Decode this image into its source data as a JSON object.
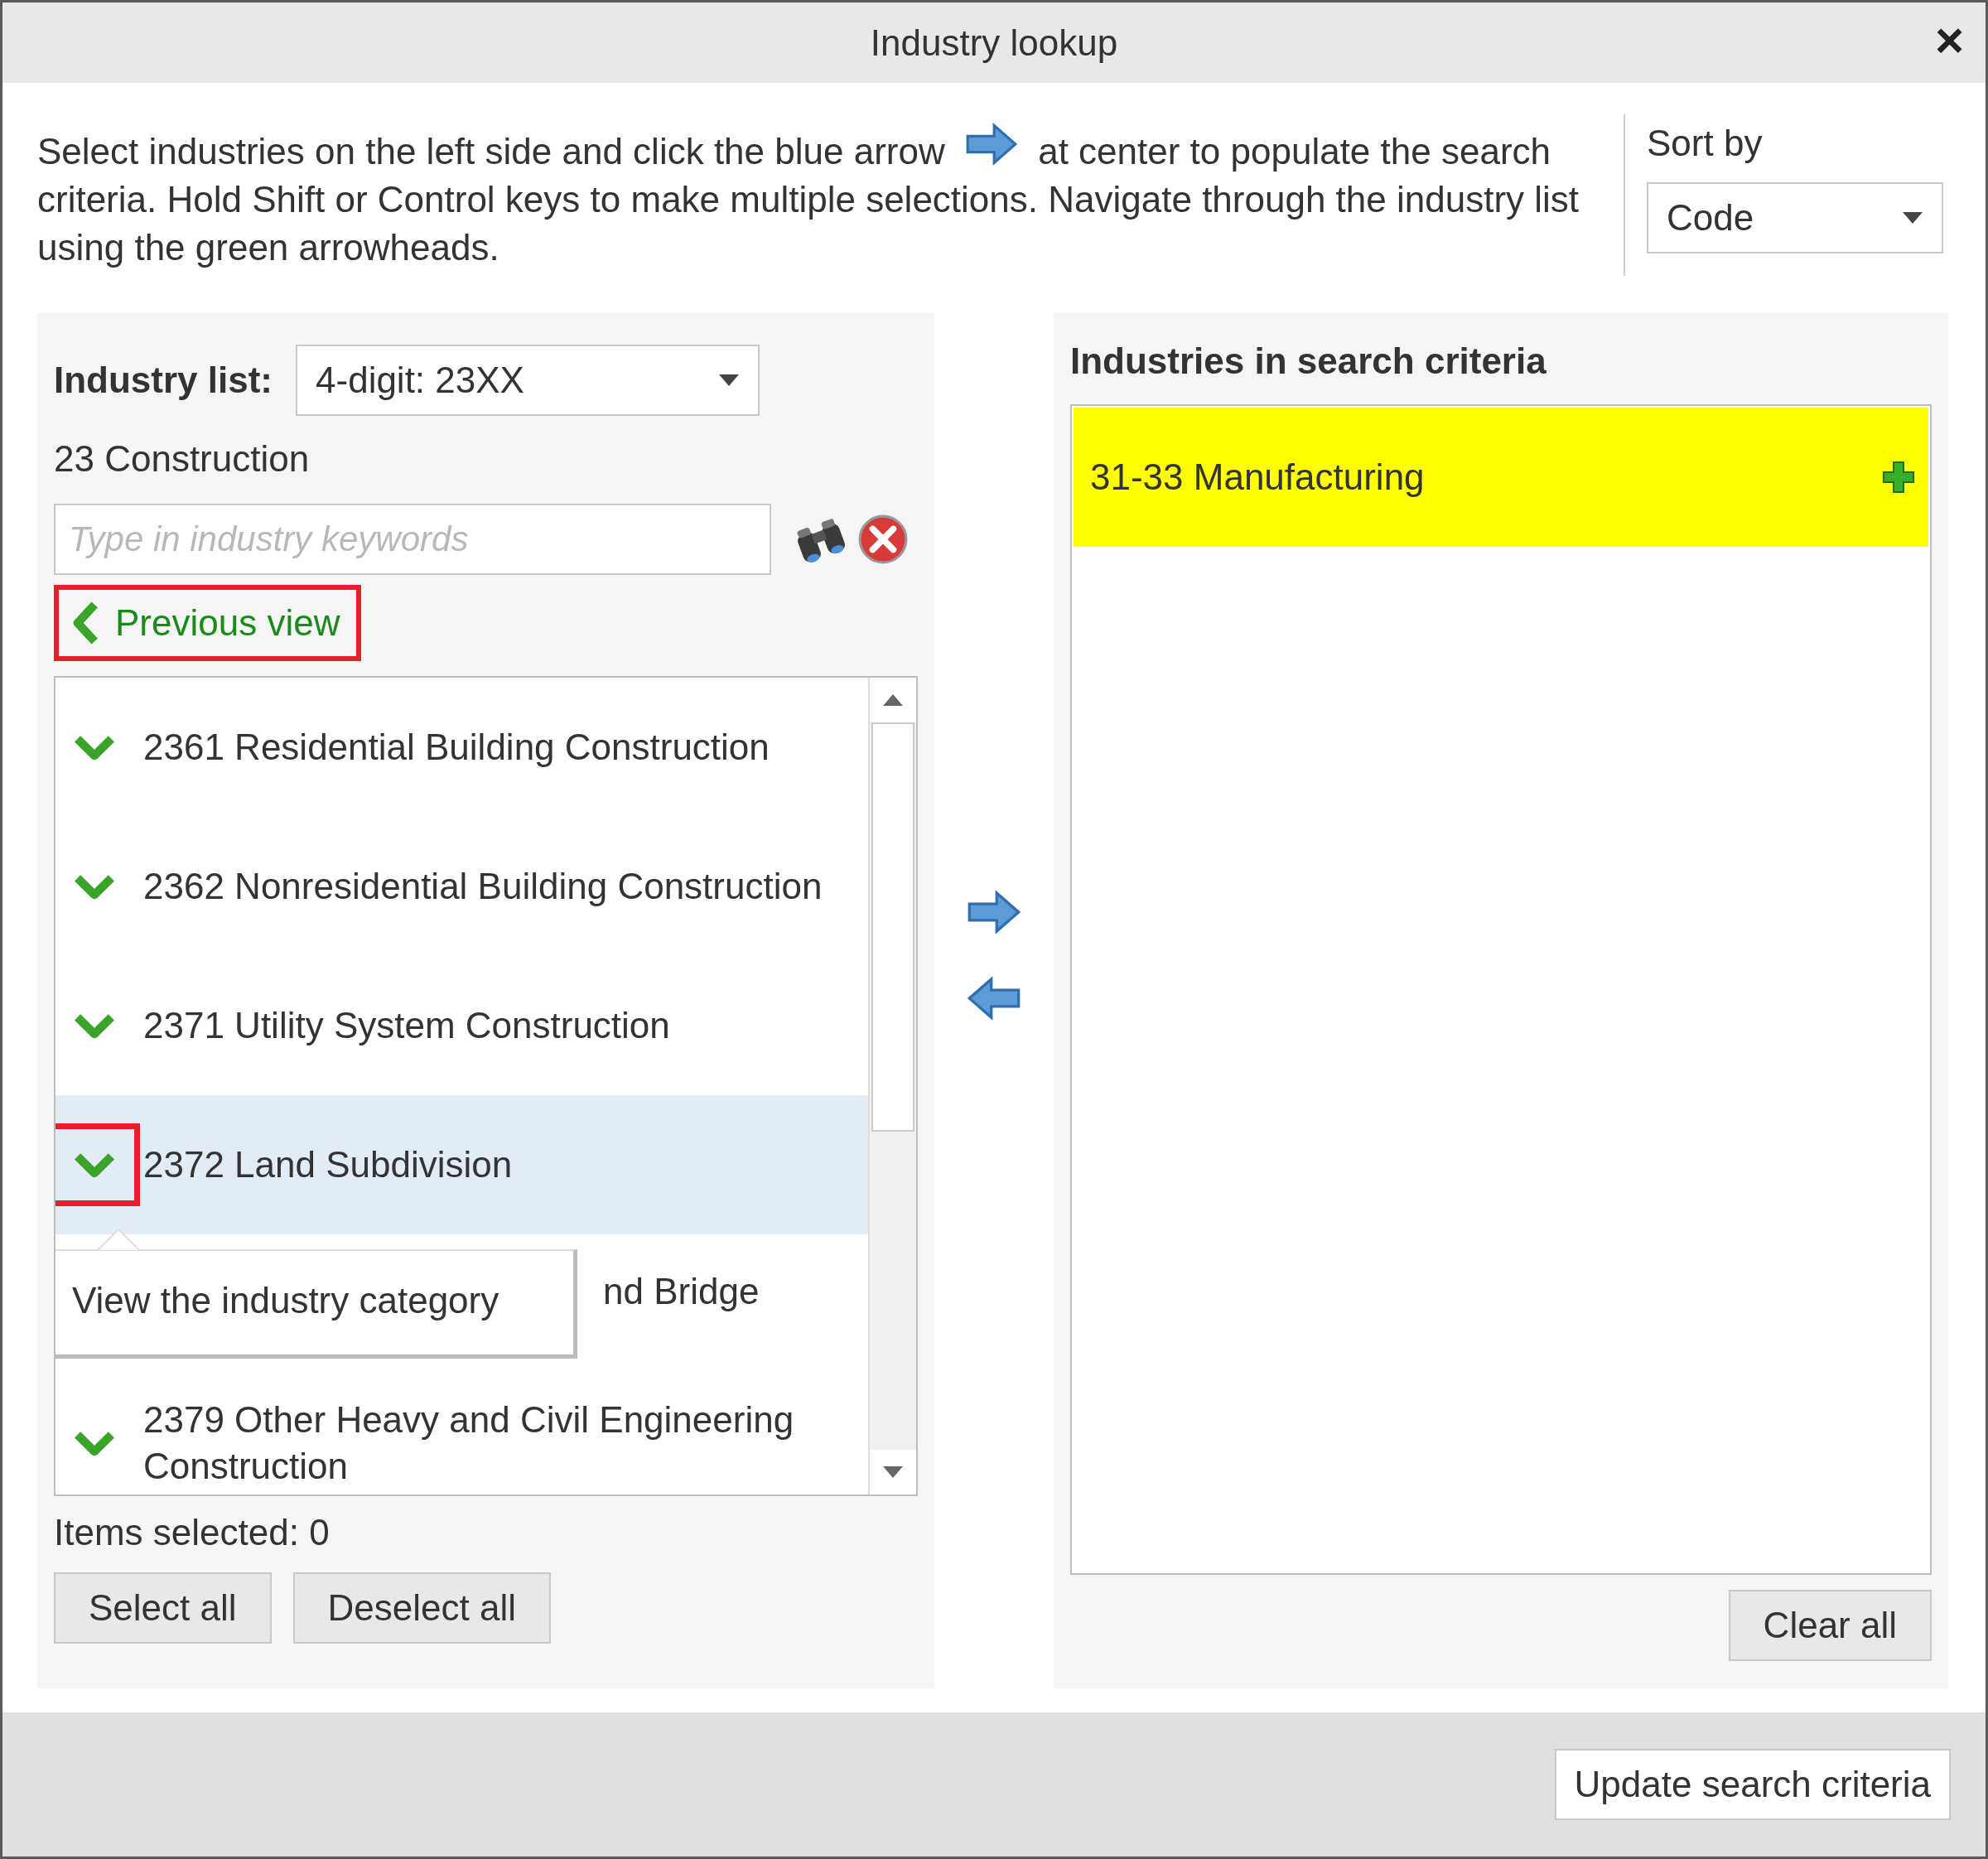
{
  "window": {
    "title": "Industry lookup",
    "close": "×"
  },
  "instructions": {
    "before": "Select industries on the left side and click the blue arrow",
    "after": "at center to populate the search criteria. Hold Shift or Control keys to make multiple selections. Navigate through the industry list using the green arrowheads."
  },
  "sort": {
    "label": "Sort by",
    "value": "Code"
  },
  "industry_list": {
    "label": "Industry list:",
    "value": "4-digit: 23XX",
    "parent": "23 Construction",
    "search_placeholder": "Type in industry keywords",
    "previous_view": {
      "label": "Previous view",
      "annotated": true
    },
    "items": [
      {
        "kind": "item",
        "label": "2361 Residential Building Construction",
        "selected": false,
        "annotated": false
      },
      {
        "kind": "item",
        "label": "2362 Nonresidential Building Construction",
        "selected": false,
        "annotated": false
      },
      {
        "kind": "item",
        "label": "2371 Utility System Construction",
        "selected": false,
        "annotated": false
      },
      {
        "kind": "item",
        "label": "2372 Land Subdivision",
        "selected": true,
        "annotated": true
      },
      {
        "kind": "covered",
        "label": "nd Bridge",
        "selected": false
      },
      {
        "kind": "item",
        "label": "2379 Other Heavy and Civil Engineering Construction",
        "selected": false,
        "annotated": false
      }
    ],
    "tooltip": "View the industry category",
    "items_selected": "Items selected: 0",
    "buttons": [
      "Select all",
      "Deselect all"
    ]
  },
  "search_criteria": {
    "title": "Industries in search criteria",
    "items": [
      {
        "label": "31-33 Manufacturing",
        "color": "#ffff00"
      }
    ],
    "buttons": [
      "Clear all"
    ]
  },
  "footer": {
    "buttons": [
      "Update search criteria"
    ]
  }
}
